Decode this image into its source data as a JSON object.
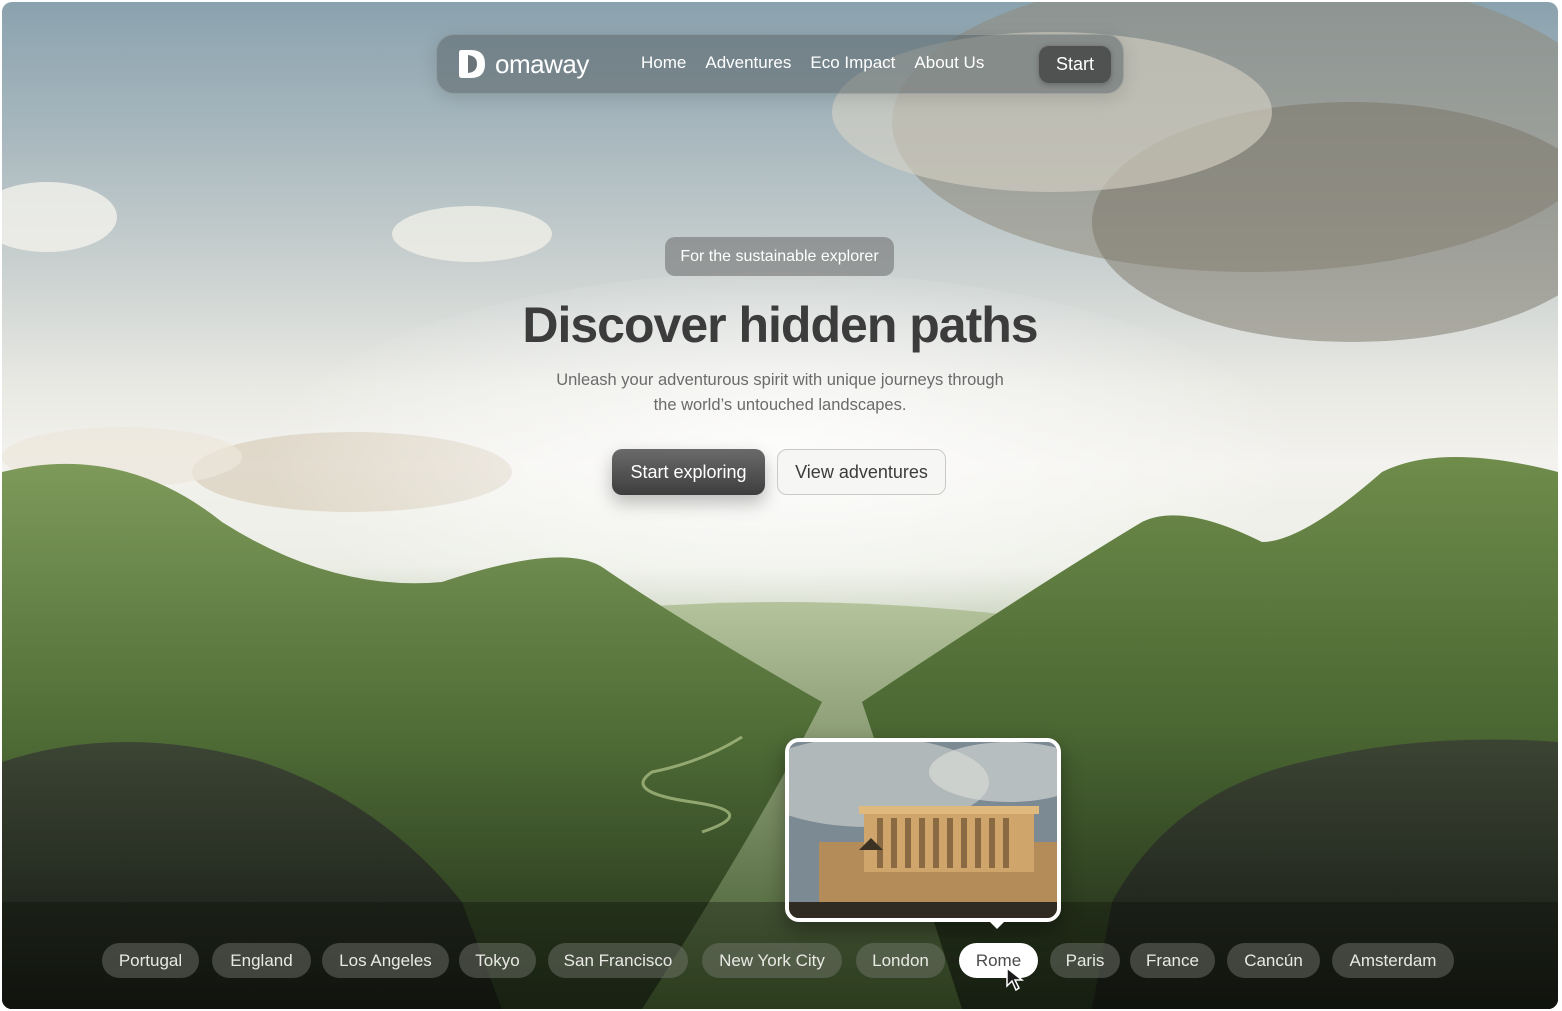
{
  "brand": {
    "name": "omaway"
  },
  "nav": {
    "links": [
      "Home",
      "Adventures",
      "Eco Impact",
      "About Us"
    ],
    "cta": "Start"
  },
  "hero": {
    "tag": "For the sustainable explorer",
    "title": "Discover hidden paths",
    "subtitle_line1": "Unleash your adventurous spirit with unique journeys through",
    "subtitle_line2": "the world’s untouched landscapes.",
    "primary_button": "Start exploring",
    "secondary_button": "View adventures"
  },
  "destinations": {
    "items": [
      "Portugal",
      "England",
      "Los Angeles",
      "Tokyo",
      "San Francisco",
      "New York City",
      "London",
      "Rome",
      "Paris",
      "France",
      "Cancún",
      "Amsterdam"
    ],
    "selected": "Rome"
  },
  "colors": {
    "nav_bg": "#5a6468",
    "primary_button": "#4a4a4a",
    "hills": "#5d7a43",
    "chip_active": "#ffffff"
  },
  "icons": {
    "logo": "omaway-logo-icon",
    "cursor": "mouse-pointer-icon"
  }
}
